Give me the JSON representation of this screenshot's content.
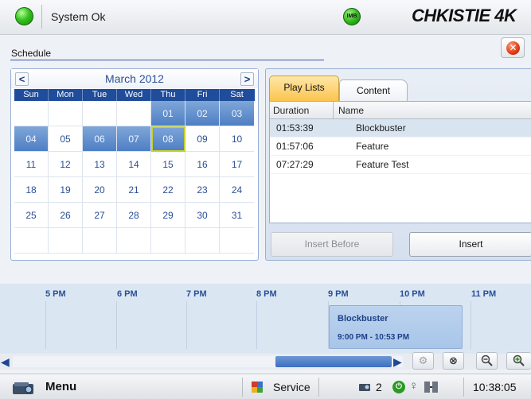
{
  "status": {
    "text": "System Ok",
    "led_color": "#2eb81c"
  },
  "imb_badge": "IMB",
  "brand": "CHKISTIE 4K",
  "schedule": {
    "title": "Schedule"
  },
  "calendar": {
    "month": "March 2012",
    "prev_label": "<",
    "next_label": ">",
    "weekdays": [
      "Sun",
      "Mon",
      "Tue",
      "Wed",
      "Thu",
      "Fri",
      "Sat"
    ],
    "weeks": [
      [
        "",
        "",
        "",
        "",
        "01",
        "02",
        "03"
      ],
      [
        "04",
        "05",
        "06",
        "07",
        "08",
        "09",
        "10"
      ],
      [
        "11",
        "12",
        "13",
        "14",
        "15",
        "16",
        "17"
      ],
      [
        "18",
        "19",
        "20",
        "21",
        "22",
        "23",
        "24"
      ],
      [
        "25",
        "26",
        "27",
        "28",
        "29",
        "30",
        "31"
      ],
      [
        "",
        "",
        "",
        "",
        "",
        "",
        ""
      ]
    ],
    "today": "08"
  },
  "playlists": {
    "tabs": {
      "playlists": "Play Lists",
      "content": "Content"
    },
    "columns": {
      "duration": "Duration",
      "name": "Name"
    },
    "rows": [
      {
        "duration": "01:53:39",
        "name": "Blockbuster"
      },
      {
        "duration": "01:57:06",
        "name": "Feature"
      },
      {
        "duration": "07:27:29",
        "name": "Feature Test"
      }
    ],
    "buttons": {
      "insert_before": "Insert Before",
      "insert": "Insert"
    }
  },
  "timeline": {
    "hours": [
      "5 PM",
      "6 PM",
      "7 PM",
      "8 PM",
      "9 PM",
      "10 PM",
      "11 PM"
    ],
    "event": {
      "title": "Blockbuster",
      "time": "9:00 PM - 10:53 PM"
    }
  },
  "taskbar": {
    "menu": "Menu",
    "service": "Service",
    "projector_count": "2",
    "time": "10:38:05"
  }
}
